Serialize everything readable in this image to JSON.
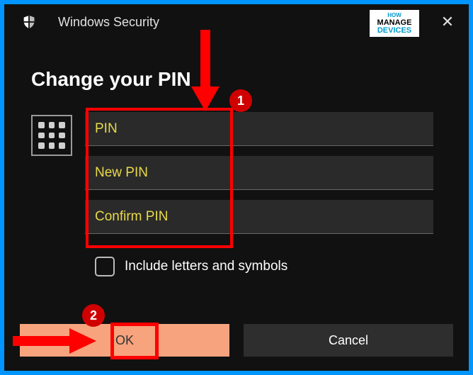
{
  "titlebar": {
    "appName": "Windows Security"
  },
  "heading": "Change your PIN",
  "fields": {
    "pin": {
      "placeholder": "PIN"
    },
    "newPin": {
      "placeholder": "New PIN"
    },
    "confirmPin": {
      "placeholder": "Confirm PIN"
    }
  },
  "checkbox": {
    "label": "Include letters and symbols"
  },
  "buttons": {
    "ok": "OK",
    "cancel": "Cancel"
  },
  "annotations": {
    "badge1": "1",
    "badge2": "2"
  },
  "logo": {
    "line1": "HOW",
    "line2": "MANAGE",
    "line3": "DEVICES"
  }
}
